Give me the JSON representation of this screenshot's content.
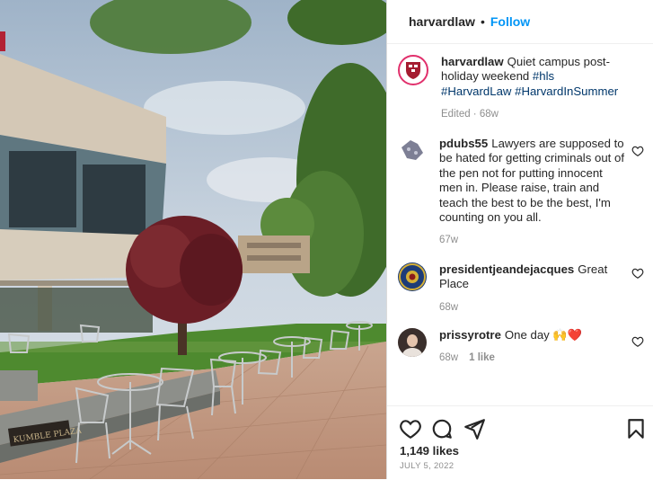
{
  "post": {
    "author": "harvardlaw",
    "follow_label": "Follow",
    "separator": "•",
    "photo_sign": "KUMBLE PLAZA"
  },
  "caption": {
    "user": "harvardlaw",
    "text": "Quiet campus post-holiday weekend",
    "hashtags": [
      "#hls",
      "#HarvardLaw",
      "#HarvardInSummer"
    ],
    "meta": "Edited · 68w"
  },
  "comments": [
    {
      "user": "pdubs55",
      "text": "Lawyers are supposed to be hated for getting criminals out of the pen not for putting innocent men in. Please raise, train and teach the best to be the best, I'm counting on you all.",
      "time": "67w"
    },
    {
      "user": "presidentjeandejacques",
      "text": "Great Place",
      "time": "68w"
    },
    {
      "user": "prissyrotre",
      "text": "One day 🙌❤️",
      "time": "68w",
      "reply": "1 like"
    }
  ],
  "footer": {
    "likes": "1,149 likes",
    "date": "JULY 5, 2022"
  },
  "colors": {
    "link": "#00376b",
    "follow": "#0095f6",
    "meta": "#8e8e8e"
  }
}
